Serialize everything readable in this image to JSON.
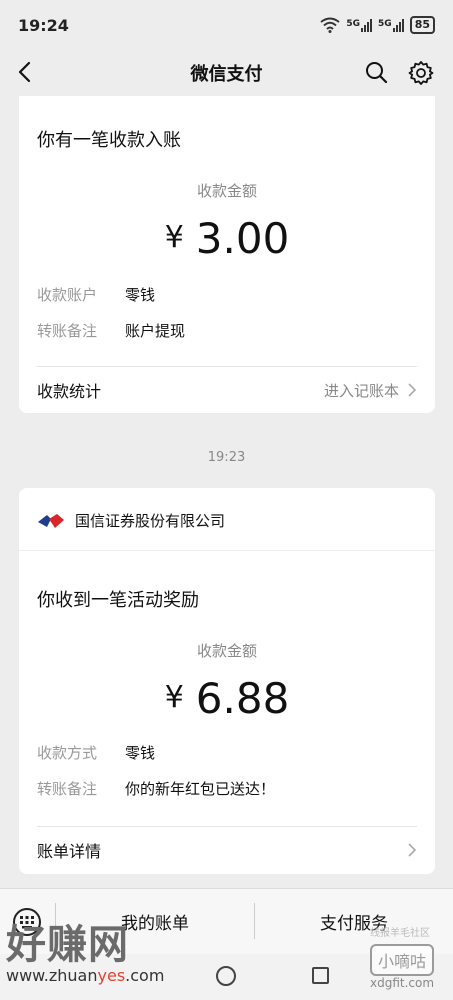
{
  "status": {
    "time": "19:24",
    "net1": "5G",
    "net2": "5G",
    "battery": "85"
  },
  "nav": {
    "title": "微信支付"
  },
  "card1": {
    "heading": "你有一笔收款入账",
    "amount_label": "收款金额",
    "currency": "¥",
    "amount": "3.00",
    "rows": [
      {
        "key": "收款账户",
        "value": "零钱"
      },
      {
        "key": "转账备注",
        "value": "账户提现"
      }
    ],
    "footer_left": "收款统计",
    "footer_right": "进入记账本"
  },
  "time_separator": "19:23",
  "card2": {
    "org_name": "国信证券股份有限公司",
    "heading": "你收到一笔活动奖励",
    "amount_label": "收款金额",
    "currency": "¥",
    "amount": "6.88",
    "rows": [
      {
        "key": "收款方式",
        "value": "零钱"
      },
      {
        "key": "转账备注",
        "value": "你的新年红包已送达！"
      }
    ],
    "footer_left": "账单详情"
  },
  "bottom_bar": {
    "my_bill": "我的账单",
    "pay_service": "支付服务"
  },
  "watermark": {
    "left_big": "好赚网",
    "left_url_a": "www.zhuan",
    "left_url_b": "yes",
    "left_url_c": ".com",
    "right_box": "小嘀咕",
    "right_url": "xdgfit.com",
    "right_tiny": "线报羊毛社区"
  },
  "colors": {
    "background": "#ededed",
    "card": "#ffffff",
    "muted": "#888888",
    "watermark_red": "#e8402c"
  }
}
